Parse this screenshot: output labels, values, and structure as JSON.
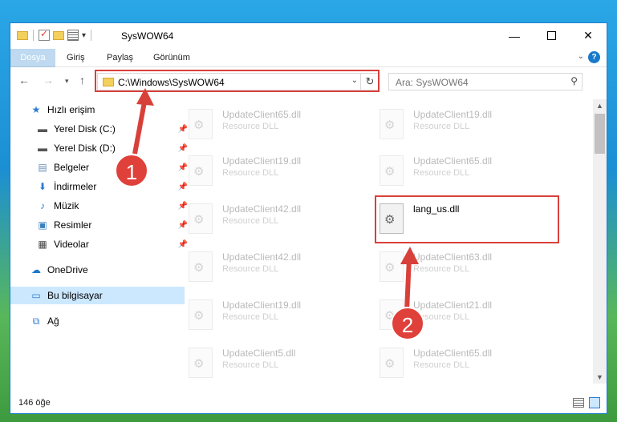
{
  "window": {
    "title": "SysWOW64"
  },
  "ribbon": {
    "tabs": [
      "Dosya",
      "Giriş",
      "Paylaş",
      "Görünüm"
    ],
    "help": "?"
  },
  "nav": {
    "address": "C:\\Windows\\SysWOW64",
    "search_placeholder": "Ara: SysWOW64"
  },
  "sidebar": {
    "items": [
      {
        "label": "Hızlı erişim",
        "icon": "star-icon",
        "pinned": false
      },
      {
        "label": "Yerel Disk (C:)",
        "icon": "drive-icon",
        "pinned": true
      },
      {
        "label": "Yerel Disk (D:)",
        "icon": "drive-icon",
        "pinned": true
      },
      {
        "label": "Belgeler",
        "icon": "documents-icon",
        "pinned": true
      },
      {
        "label": "İndirmeler",
        "icon": "download-icon",
        "pinned": true
      },
      {
        "label": "Müzik",
        "icon": "music-icon",
        "pinned": true
      },
      {
        "label": "Resimler",
        "icon": "pictures-icon",
        "pinned": true
      },
      {
        "label": "Videolar",
        "icon": "video-icon",
        "pinned": true
      },
      {
        "label": "OneDrive",
        "icon": "cloud-icon",
        "pinned": false
      },
      {
        "label": "Bu bilgisayar",
        "icon": "computer-icon",
        "pinned": false,
        "selected": true
      },
      {
        "label": "Ağ",
        "icon": "network-icon",
        "pinned": false
      }
    ]
  },
  "files": {
    "left": [
      {
        "name": "UpdateClient65.dll",
        "type": "Resource DLL"
      },
      {
        "name": "UpdateClient19.dll",
        "type": "Resource DLL"
      },
      {
        "name": "UpdateClient42.dll",
        "type": "Resource DLL"
      },
      {
        "name": "UpdateClient42.dll",
        "type": "Resource DLL"
      },
      {
        "name": "UpdateClient19.dll",
        "type": "Resource DLL"
      },
      {
        "name": "UpdateClient5.dll",
        "type": "Resource DLL"
      }
    ],
    "right": [
      {
        "name": "UpdateClient19.dll",
        "type": "Resource DLL"
      },
      {
        "name": "UpdateClient65.dll",
        "type": "Resource DLL"
      },
      {
        "name": "lang_us.dll",
        "type": ""
      },
      {
        "name": "UpdateClient63.dll",
        "type": "Resource DLL"
      },
      {
        "name": "UpdateClient21.dll",
        "type": "Resource DLL"
      },
      {
        "name": "UpdateClient65.dll",
        "type": "Resource DLL"
      }
    ]
  },
  "status": {
    "count": "146 öğe"
  },
  "annotations": {
    "step1": "1",
    "step2": "2",
    "color": "#d8403a"
  }
}
